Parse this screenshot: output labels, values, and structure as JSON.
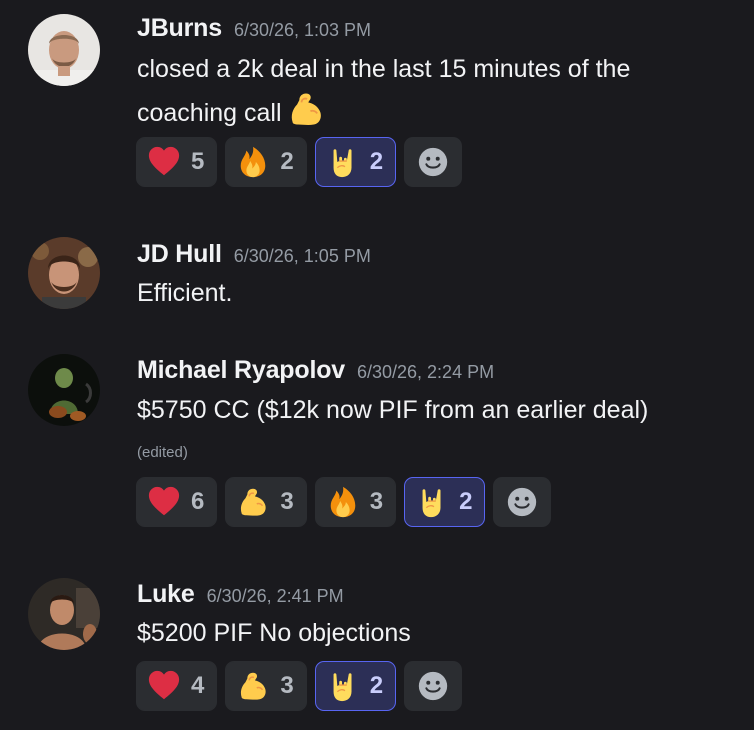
{
  "messages": [
    {
      "author": "JBurns",
      "timestamp": "6/30/26, 1:03 PM",
      "lines": [
        "closed a 2k deal in the last 15 minutes of the",
        "coaching call"
      ],
      "inline_emoji": "flexed-biceps",
      "reactions": [
        {
          "emoji": "red-heart",
          "count": "5",
          "active": false
        },
        {
          "emoji": "fire",
          "count": "2",
          "active": false
        },
        {
          "emoji": "sign-of-the-horns",
          "count": "2",
          "active": true
        }
      ]
    },
    {
      "author": "JD Hull",
      "timestamp": "6/30/26, 1:05 PM",
      "lines": [
        "Efficient."
      ]
    },
    {
      "author": "Michael Ryapolov",
      "timestamp": "6/30/26, 2:24 PM",
      "lines": [
        "$5750 CC ($12k now PIF from an earlier deal)"
      ],
      "edited": "(edited)",
      "reactions": [
        {
          "emoji": "red-heart",
          "count": "6",
          "active": false
        },
        {
          "emoji": "flexed-biceps",
          "count": "3",
          "active": false
        },
        {
          "emoji": "fire",
          "count": "3",
          "active": false
        },
        {
          "emoji": "sign-of-the-horns",
          "count": "2",
          "active": true
        }
      ]
    },
    {
      "author": "Luke",
      "timestamp": "6/30/26, 2:41 PM",
      "lines": [
        "$5200 PIF No objections"
      ],
      "reactions": [
        {
          "emoji": "red-heart",
          "count": "4",
          "active": false
        },
        {
          "emoji": "flexed-biceps",
          "count": "3",
          "active": false
        },
        {
          "emoji": "sign-of-the-horns",
          "count": "2",
          "active": true
        }
      ]
    }
  ],
  "add_reaction_icon": "smiley-add-reaction-icon",
  "colors": {
    "background": "#1a1a1e",
    "reaction_bg": "#2b2d31",
    "reaction_active_bg": "#2c2f56",
    "reaction_active_border": "#5865f2",
    "timestamp": "#949ba4",
    "text": "#f2f3f5"
  }
}
